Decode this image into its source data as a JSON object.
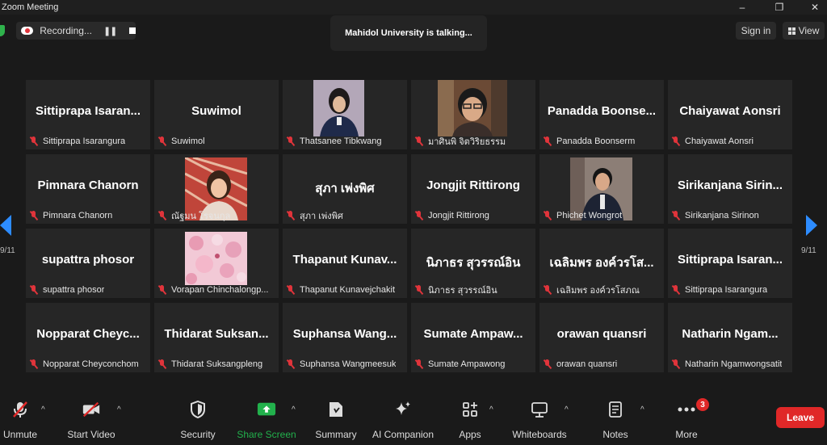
{
  "window": {
    "title": "Zoom Meeting"
  },
  "recording": {
    "label": "Recording..."
  },
  "talking": {
    "text": "Mahidol University is talking..."
  },
  "header": {
    "signin": "Sign in",
    "view": "View"
  },
  "page": {
    "left": "9/11",
    "right": "9/11"
  },
  "tiles": [
    {
      "big": "Sittiprapa  Isaran...",
      "name": "Sittiprapa Isarangura"
    },
    {
      "big": "Suwimol",
      "name": "Suwimol"
    },
    {
      "big": "",
      "name": "Thatsanee Tibkwang"
    },
    {
      "big": "",
      "name": "มาศินพิ จิตวิริยธรรม"
    },
    {
      "big": "Panadda  Boonse...",
      "name": "Panadda Boonserm"
    },
    {
      "big": "Chaiyawat Aonsri",
      "name": "Chaiyawat Aonsri"
    },
    {
      "big": "Pimnara Chanorn",
      "name": "Pimnara Chanorn"
    },
    {
      "big": "",
      "name": "ณัฐมน โรจนกุล"
    },
    {
      "big": "สุภา เพ่งพิศ",
      "name": "สุภา เพ่งพิศ"
    },
    {
      "big": "Jongjit Rittirong",
      "name": "Jongjit Rittirong"
    },
    {
      "big": "",
      "name": "Phichet Wongrot"
    },
    {
      "big": "Sirikanjana  Sirin...",
      "name": "Sirikanjana Sirinon"
    },
    {
      "big": "supattra phosor",
      "name": "supattra phosor"
    },
    {
      "big": "",
      "name": "Vorapan Chinchalongp..."
    },
    {
      "big": "Thapanut  Kunav...",
      "name": "Thapanut Kunavejchakit"
    },
    {
      "big": "นิภาธร สุวรรณ์อิน",
      "name": "นิภาธร สุวรรณ์อิน"
    },
    {
      "big": "เฉลิมพร องค์วรโส...",
      "name": "เฉลิมพร องค์วรโสภณ"
    },
    {
      "big": "Sittiprapa  Isaran...",
      "name": "Sittiprapa Isarangura"
    },
    {
      "big": "Nopparat  Cheyc...",
      "name": "Nopparat Cheyconchom"
    },
    {
      "big": "Thidarat  Suksan...",
      "name": "Thidarat Suksangpleng"
    },
    {
      "big": "Suphansa  Wang...",
      "name": "Suphansa Wangmeesuk"
    },
    {
      "big": "Sumate  Ampaw...",
      "name": "Sumate Ampawong"
    },
    {
      "big": "orawan quansri",
      "name": "orawan quansri"
    },
    {
      "big": "Natharin  Ngam...",
      "name": "Natharin Ngamwongsatit"
    }
  ],
  "toolbar": {
    "unmute": "Unmute",
    "start_video": "Start Video",
    "security": "Security",
    "share_screen": "Share Screen",
    "summary": "Summary",
    "ai_companion": "AI Companion",
    "apps": "Apps",
    "whiteboards": "Whiteboards",
    "notes": "Notes",
    "more": "More",
    "more_badge": "3",
    "leave": "Leave"
  },
  "colors": {
    "accent": "#2d8cff",
    "share": "#22b14c",
    "danger": "#e02828"
  }
}
